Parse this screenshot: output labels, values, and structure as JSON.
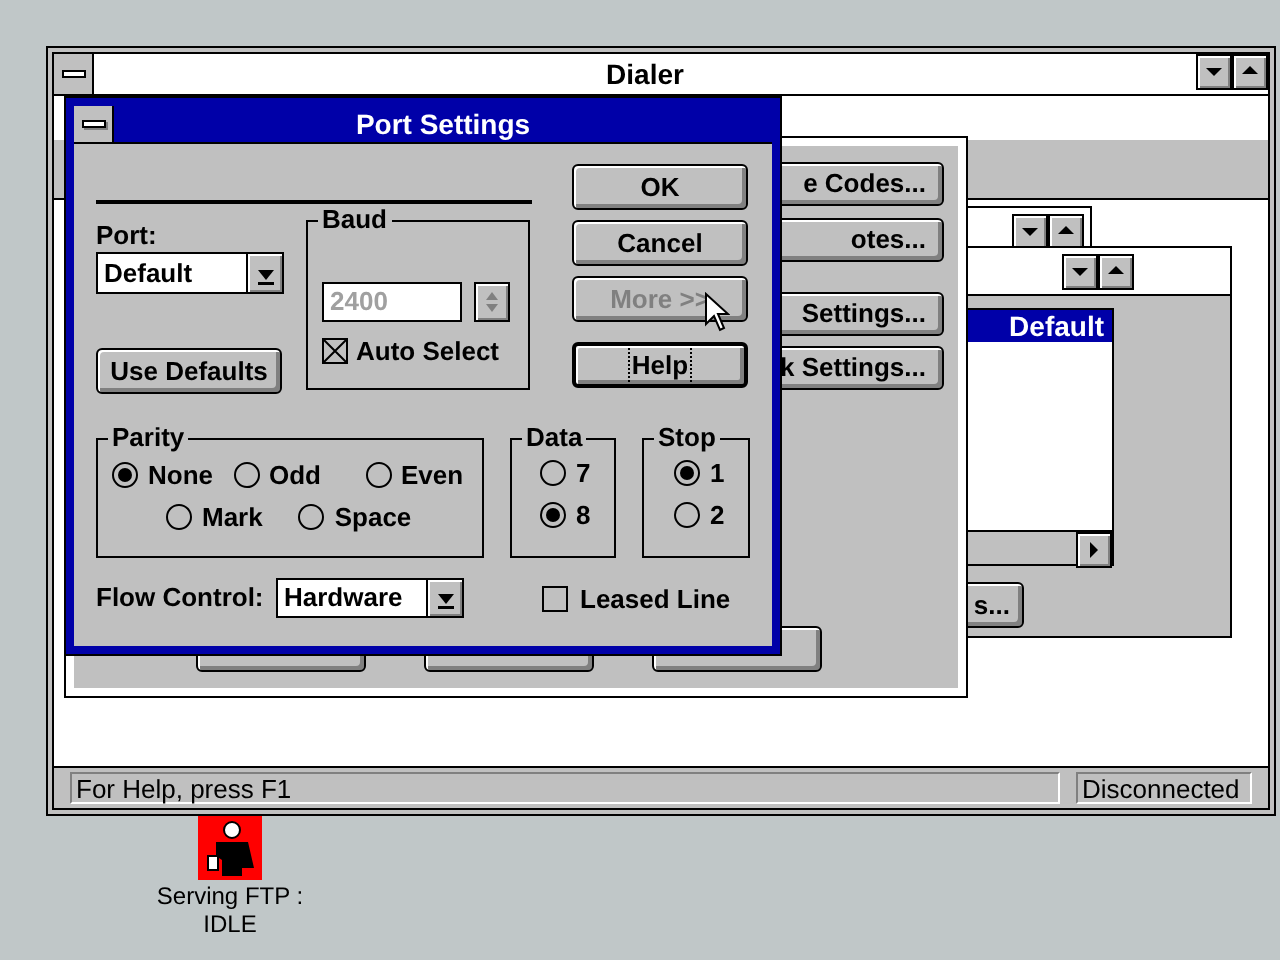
{
  "dialer": {
    "title": "Dialer",
    "status_text": "For Help, press F1",
    "connection_status": "Disconnected"
  },
  "settings_dialog": {
    "buttons": [
      {
        "label": "e Codes..."
      },
      {
        "label": "otes..."
      },
      {
        "label": "Settings..."
      },
      {
        "label": "k Settings..."
      }
    ]
  },
  "profile_window": {
    "list_items": [
      {
        "label": "Default",
        "selected": true
      }
    ],
    "button": "s..."
  },
  "port_settings": {
    "title": "Port Settings",
    "port": {
      "label": "Port:",
      "value": "Default"
    },
    "use_defaults": "Use Defaults",
    "baud": {
      "label": "Baud",
      "value": "2400",
      "disabled": true,
      "auto_select": {
        "label": "Auto Select",
        "checked": true
      }
    },
    "buttons": [
      {
        "label": "OK",
        "disabled": false,
        "default": false
      },
      {
        "label": "Cancel",
        "disabled": false,
        "default": false
      },
      {
        "label": "More >>",
        "disabled": true,
        "default": false
      },
      {
        "label": "Help",
        "disabled": false,
        "default": true
      }
    ],
    "parity": {
      "label": "Parity",
      "options": [
        {
          "label": "None",
          "selected": true
        },
        {
          "label": "Odd",
          "selected": false
        },
        {
          "label": "Even",
          "selected": false
        },
        {
          "label": "Mark",
          "selected": false
        },
        {
          "label": "Space",
          "selected": false
        }
      ]
    },
    "data": {
      "label": "Data",
      "options": [
        {
          "label": "7",
          "selected": false
        },
        {
          "label": "8",
          "selected": true
        }
      ]
    },
    "stop": {
      "label": "Stop",
      "options": [
        {
          "label": "1",
          "selected": true
        },
        {
          "label": "2",
          "selected": false
        }
      ]
    },
    "flow_control": {
      "label": "Flow Control:",
      "value": "Hardware"
    },
    "leased_line": {
      "label": "Leased Line",
      "checked": false
    }
  },
  "desktop_icon": {
    "lines": [
      "Serving FTP :",
      "IDLE"
    ]
  }
}
